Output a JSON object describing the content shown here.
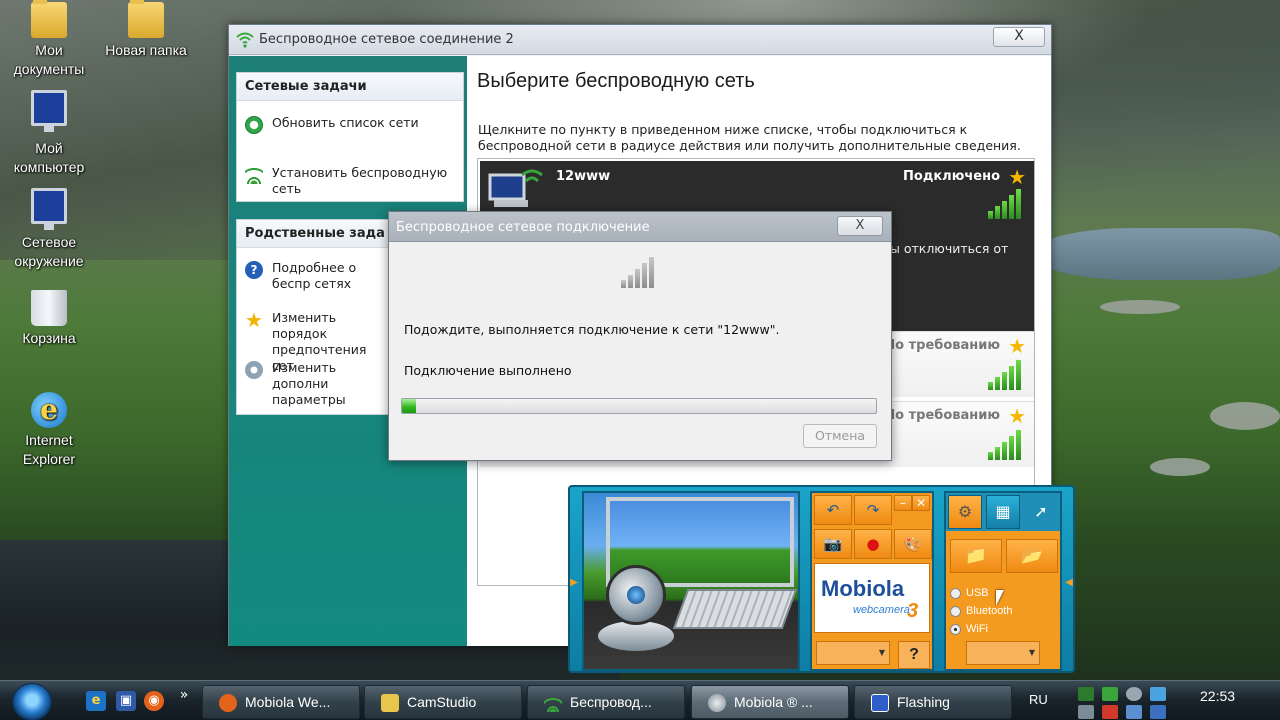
{
  "desktop": {
    "icons": [
      {
        "label_1": "Мои",
        "label_2": "документы"
      },
      {
        "label_1": "Новая папка",
        "label_2": ""
      },
      {
        "label_1": "Мой",
        "label_2": "компьютер"
      },
      {
        "label_1": "Сетевое",
        "label_2": "окружение"
      },
      {
        "label_1": "Корзина",
        "label_2": ""
      },
      {
        "label_1": "Internet",
        "label_2": "Explorer"
      }
    ]
  },
  "window": {
    "title": "Беспроводное сетевое соединение 2",
    "close_label": "X",
    "tasks_panel": {
      "header": "Сетевые задачи",
      "items": [
        {
          "label": "Обновить список сети",
          "icon": "refresh-icon"
        },
        {
          "label": "Установить беспроводную сеть",
          "icon": "wifi-setup-icon"
        }
      ]
    },
    "related_panel": {
      "header": "Родственные зада",
      "items": [
        {
          "label": "Подробнее о беспр сетях",
          "icon": "help-icon"
        },
        {
          "label": "Изменить порядок предпочтения сет",
          "icon": "star-icon"
        },
        {
          "label": "Изменить дополни параметры",
          "icon": "settings-icon"
        }
      ]
    },
    "main": {
      "heading": "Выберите беспроводную сеть",
      "description": "Щелкните по пункту в приведенном ниже списке, чтобы подключиться к беспроводной сети в радиусе действия или получить дополнительные сведения.",
      "networks": [
        {
          "name": "12www",
          "status": "Подключено",
          "hint": "ы отключиться от",
          "selected": true
        },
        {
          "name": "",
          "status": "По требованию",
          "selected": false
        },
        {
          "name": "",
          "status": "По требованию",
          "selected": false
        }
      ]
    }
  },
  "dialog": {
    "title": "Беспроводное сетевое подключение",
    "close_label": "X",
    "message": "Подождите, выполняется подключение к сети \"12www\".",
    "status": "Подключение выполнено",
    "progress_fraction": 0.03,
    "cancel_label": "Отмена"
  },
  "mobiola": {
    "brand": "Mobiola",
    "sub": "webcamera",
    "version": "3",
    "help_label": "?",
    "connections": [
      {
        "label": "USB",
        "selected": false
      },
      {
        "label": "Bluetooth",
        "selected": false
      },
      {
        "label": "WiFi",
        "selected": true
      }
    ]
  },
  "taskbar": {
    "buttons": [
      {
        "label": "Mobiola We...",
        "icon": "firefox-icon",
        "active": false
      },
      {
        "label": "CamStudio",
        "icon": "camstudio-icon",
        "active": false
      },
      {
        "label": "Беспровод...",
        "icon": "wireless-icon",
        "active": false
      },
      {
        "label": "Mobiola ® ...",
        "icon": "mobiola-icon",
        "active": true
      },
      {
        "label": "Flashing",
        "icon": "flashing-icon",
        "active": false
      }
    ],
    "language": "RU",
    "clock": "22:53",
    "overflow": "»"
  },
  "colors": {
    "sidebar": "#138a80",
    "accent_green": "#2fb51d",
    "mobiola_orange": "#f49a1e",
    "mobiola_blue": "#1aa4c9"
  }
}
